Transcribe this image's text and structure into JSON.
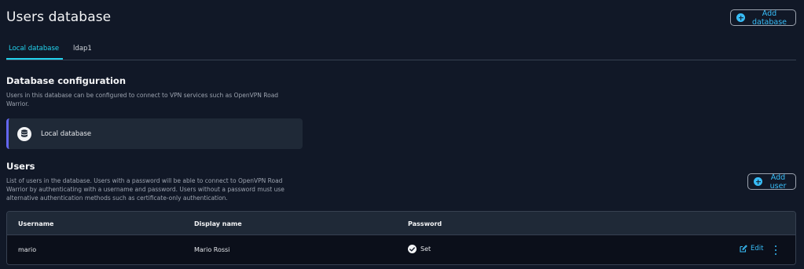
{
  "page": {
    "title": "Users database"
  },
  "header": {
    "add_database_label": "Add database"
  },
  "tabs": [
    {
      "label": "Local database",
      "active": true
    },
    {
      "label": "ldap1",
      "active": false
    }
  ],
  "config": {
    "title": "Database configuration",
    "description_line1": "Users in this database can be configured to connect to VPN services such as OpenVPN Road",
    "description_line2": "Warrior.",
    "card_label": "Local database",
    "card_icon": "database-icon"
  },
  "users": {
    "title": "Users",
    "description_line1": "List of users in the database. Users with a password will be able to connect to OpenVPN Road",
    "description_line2": "Warrior by authenticating with a username and password. Users without a password must use",
    "description_line3": "alternative authentication methods such as certificate-only authentication.",
    "add_user_label": "Add user",
    "table": {
      "headers": [
        "Username",
        "Display name",
        "Password"
      ],
      "rows": [
        {
          "username": "mario",
          "display_name": "Mario Rossi",
          "password": "Set",
          "edit_label": "Edit"
        }
      ]
    }
  },
  "colors": {
    "background": "#111827",
    "accent": "#38bdf8",
    "tab_active": "#22d3ee",
    "card_border": "#6366f1"
  }
}
